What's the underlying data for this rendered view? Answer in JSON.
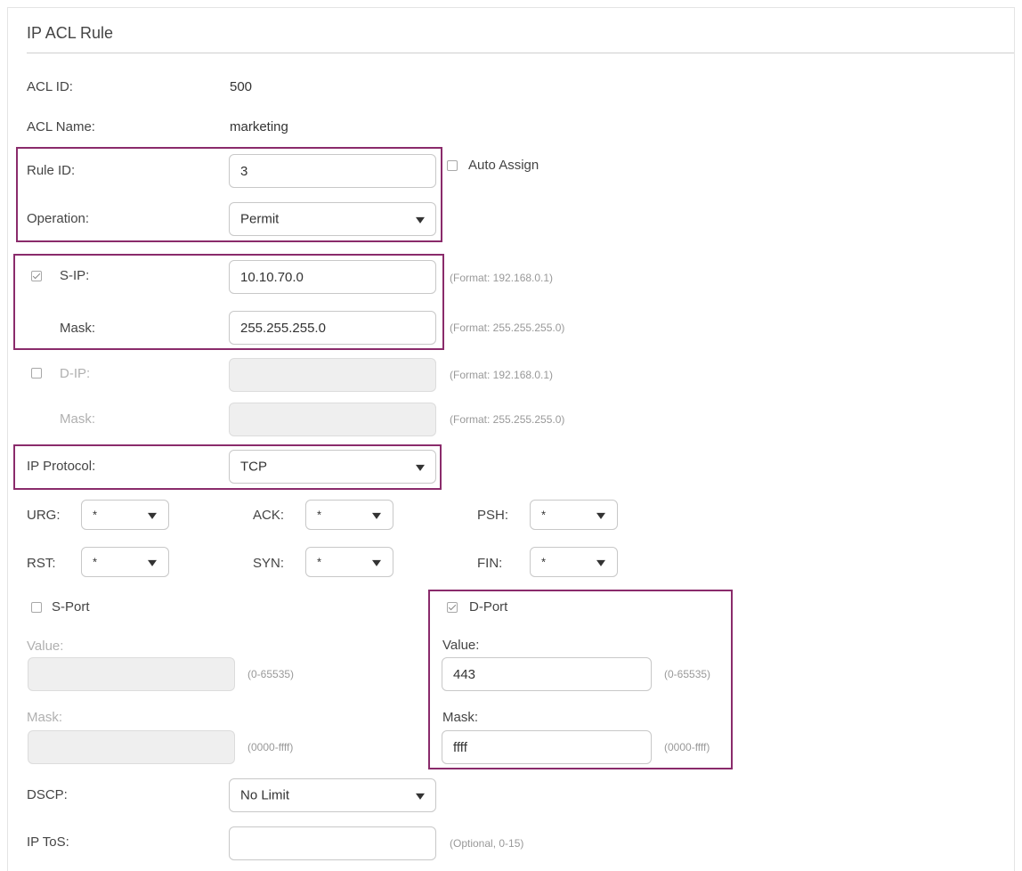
{
  "panel": {
    "title": "IP ACL Rule"
  },
  "acl": {
    "id_label": "ACL ID:",
    "id_value": "500",
    "name_label": "ACL Name:",
    "name_value": "marketing"
  },
  "rule": {
    "id_label": "Rule ID:",
    "id_value": "3",
    "auto_assign_label": "Auto Assign",
    "auto_assign_checked": false,
    "operation_label": "Operation:",
    "operation_value": "Permit"
  },
  "sip": {
    "label": "S-IP:",
    "checked": true,
    "value": "10.10.70.0",
    "hint": "(Format: 192.168.0.1)",
    "mask_label": "Mask:",
    "mask_value": "255.255.255.0",
    "mask_hint": "(Format: 255.255.255.0)"
  },
  "dip": {
    "label": "D-IP:",
    "checked": false,
    "value": "",
    "hint": "(Format: 192.168.0.1)",
    "mask_label": "Mask:",
    "mask_value": "",
    "mask_hint": "(Format: 255.255.255.0)"
  },
  "protocol": {
    "label": "IP Protocol:",
    "value": "TCP"
  },
  "flags": {
    "urg": {
      "label": "URG:",
      "value": "*"
    },
    "ack": {
      "label": "ACK:",
      "value": "*"
    },
    "psh": {
      "label": "PSH:",
      "value": "*"
    },
    "rst": {
      "label": "RST:",
      "value": "*"
    },
    "syn": {
      "label": "SYN:",
      "value": "*"
    },
    "fin": {
      "label": "FIN:",
      "value": "*"
    }
  },
  "sport": {
    "label": "S-Port",
    "checked": false,
    "value_label": "Value:",
    "value": "",
    "value_hint": "(0-65535)",
    "mask_label": "Mask:",
    "mask_value": "",
    "mask_hint": "(0000-ffff)"
  },
  "dport": {
    "label": "D-Port",
    "checked": true,
    "value_label": "Value:",
    "value": "443",
    "value_hint": "(0-65535)",
    "mask_label": "Mask:",
    "mask_value": "ffff",
    "mask_hint": "(0000-ffff)"
  },
  "dscp": {
    "label": "DSCP:",
    "value": "No Limit"
  },
  "tos": {
    "label": "IP ToS:",
    "value": "",
    "hint": "(Optional, 0-15)"
  },
  "colors": {
    "highlight": "#8a2b6b",
    "disabled_bg": "#efefef"
  }
}
